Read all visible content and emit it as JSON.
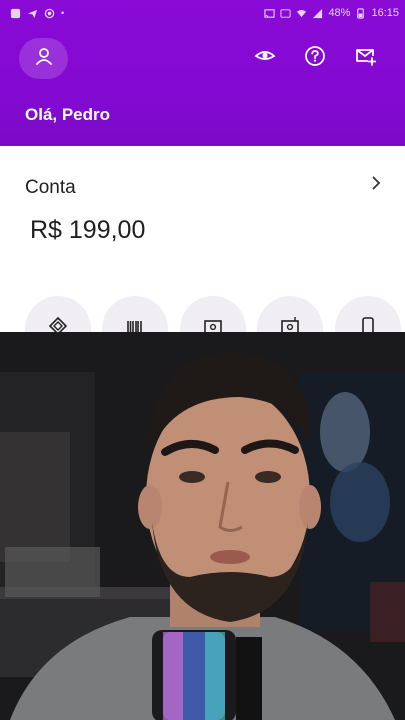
{
  "status_bar": {
    "battery": "48%",
    "time": "16:15"
  },
  "header": {
    "greeting": "Olá, Pedro"
  },
  "account": {
    "title": "Conta",
    "balance": "R$ 199,00"
  },
  "icons": {
    "profile": "person-icon",
    "visibility": "eye-icon",
    "help": "question-circle-icon",
    "invite": "mail-plus-icon",
    "chevron": "chevron-right-icon",
    "shortcuts": [
      "pix-icon",
      "barcode-icon",
      "transfer-icon",
      "deposit-icon",
      "phone-icon"
    ]
  },
  "colors": {
    "brand_purple": "#820ad1",
    "text_dark": "#1f1f1f",
    "shortcut_bg": "#f0eef2"
  }
}
